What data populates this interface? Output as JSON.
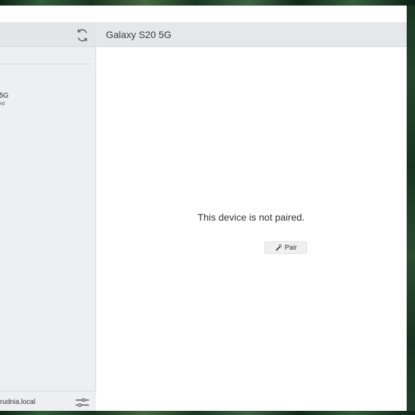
{
  "device_list": {
    "item": {
      "name": "5G",
      "status": "ed"
    }
  },
  "footer": {
    "host": "rudnia.local"
  },
  "detail": {
    "title": "Galaxy S20 5G",
    "message": "This device is not paired.",
    "pair_button": "Pair"
  },
  "icons": {
    "refresh": "refresh-icon",
    "settings": "sliders-icon",
    "pair": "link-icon"
  },
  "colors": {
    "window_bg": "#ffffff",
    "sidebar_bg": "#eeeff1",
    "header_bg": "#e6e7ea",
    "button_bg": "#f0f0f0"
  }
}
